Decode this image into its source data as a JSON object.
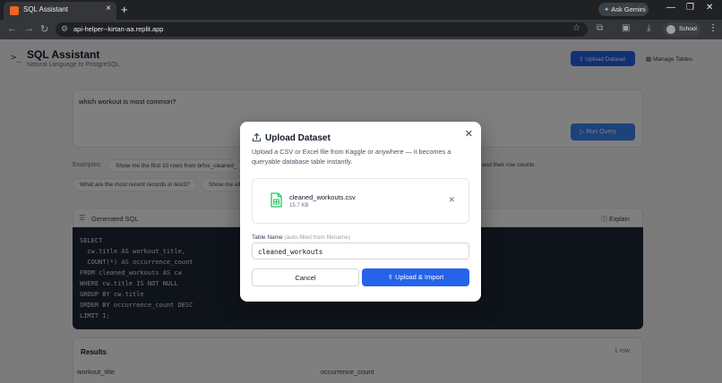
{
  "browser": {
    "tab_title": "SQL Assistant",
    "gemini_label": "Ask Gemini",
    "url": "api-helper--kirtan-aa.replit.app",
    "profile_label": "School"
  },
  "app": {
    "title": "SQL Assistant",
    "subtitle": "Natural Language to PostgreSQL",
    "upload_button": "Upload Dataset",
    "manage_button": "Manage Tables",
    "query_text": "which workout is most common?",
    "run_button": "Run Query",
    "examples_label": "Examples:",
    "examples": [
      "Show me the first 10 rows from brfss_cleaned_",
      "and their row counts",
      "What are the most recent records in test3?",
      "Show me all"
    ],
    "sql_header": "Generated SQL",
    "explain": "Explain",
    "sql_lines": [
      "SELECT",
      "  cw.title AS workout_title,",
      "  COUNT(*) AS occurrence_count",
      "FROM cleaned_workouts AS cw",
      "WHERE cw.title IS NOT NULL",
      "GROUP BY cw.title",
      "ORDER BY occurrence_count DESC",
      "LIMIT 1;"
    ],
    "results_title": "Results",
    "results_count": "1 row",
    "columns": [
      "workout_title",
      "occurrence_count"
    ]
  },
  "modal": {
    "title": "Upload Dataset",
    "description": "Upload a CSV or Excel file from Kaggle or anywhere — it becomes a queryable database table instantly.",
    "file_name": "cleaned_workouts.csv",
    "file_size": "15.7 KB",
    "table_name_label": "Table Name",
    "table_name_hint": "(auto-filled from filename)",
    "table_name_value": "cleaned_workouts",
    "cancel": "Cancel",
    "import": "Upload & Import"
  },
  "colors": {
    "primary": "#2563eb",
    "overlay": "rgba(0,0,0,0.5)",
    "sql_bg": "#1f2937",
    "file_icon": "#22c55e"
  }
}
